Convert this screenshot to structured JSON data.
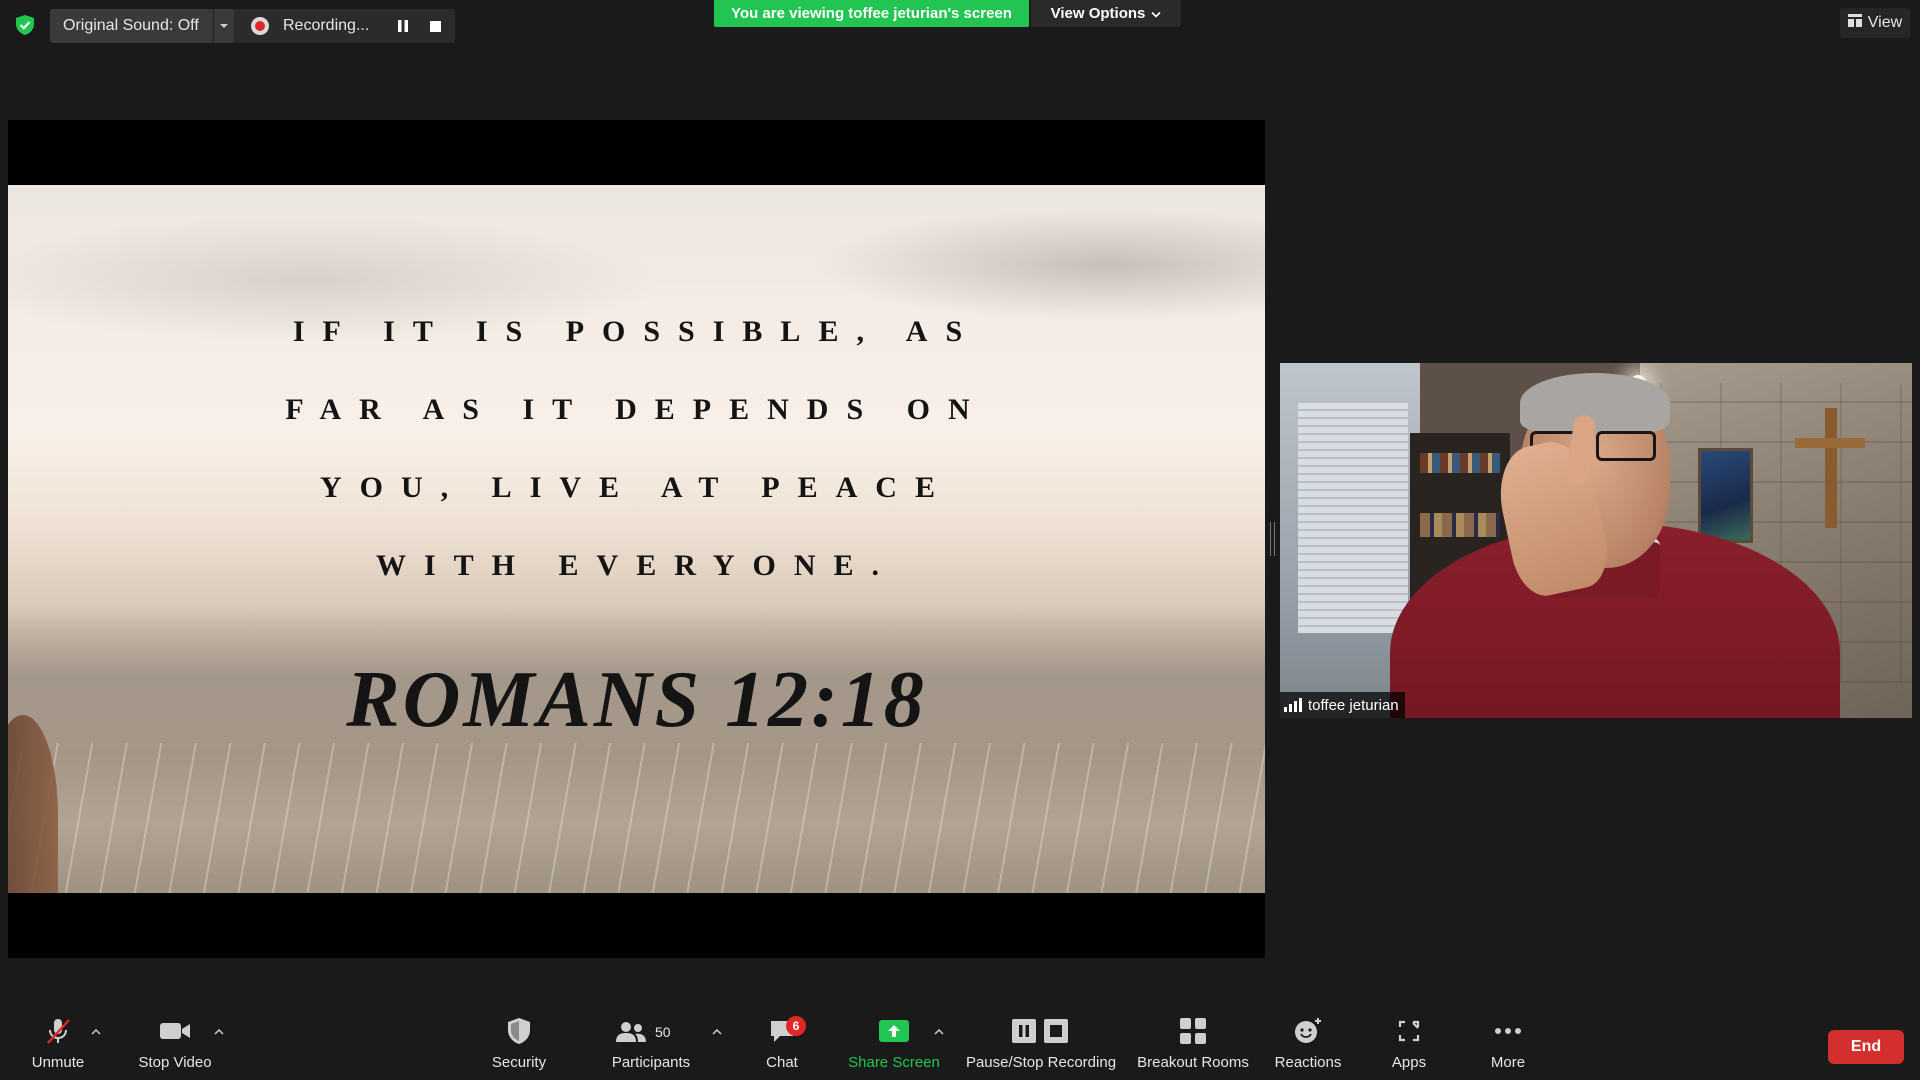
{
  "top_bar": {
    "original_sound_label": "Original Sound: Off",
    "recording_label": "Recording...",
    "viewing_banner": "You are viewing toffee jeturian's screen",
    "view_options_label": "View Options",
    "view_label": "View"
  },
  "shared_screen": {
    "verse_lines": [
      "IF IT IS POSSIBLE, AS",
      "FAR AS IT DEPENDS ON",
      "YOU, LIVE AT PEACE",
      "WITH EVERYONE."
    ],
    "reference": "ROMANS 12:18"
  },
  "participant_video": {
    "name": "toffee jeturian"
  },
  "toolbar": {
    "unmute_label": "Unmute",
    "stop_video_label": "Stop Video",
    "security_label": "Security",
    "participants_label": "Participants",
    "participants_count": "50",
    "chat_label": "Chat",
    "chat_badge": "6",
    "share_screen_label": "Share Screen",
    "pause_stop_recording_label": "Pause/Stop Recording",
    "breakout_rooms_label": "Breakout Rooms",
    "reactions_label": "Reactions",
    "apps_label": "Apps",
    "more_label": "More",
    "end_label": "End"
  },
  "colors": {
    "accent_green": "#23c552",
    "end_red": "#d32f2f",
    "background": "#1a1a1a"
  },
  "icons": [
    "shield-check-icon",
    "caret-down-icon",
    "record-dot-icon",
    "pause-icon",
    "stop-icon",
    "chevron-down-icon",
    "grid-view-icon",
    "signal-bars-icon",
    "muted-mic-icon",
    "video-camera-icon",
    "security-shield-icon",
    "participants-icon",
    "chat-bubble-icon",
    "share-screen-arrow-icon",
    "pause-stop-recording-icon",
    "breakout-rooms-icon",
    "reactions-icon",
    "apps-icon",
    "more-dots-icon"
  ]
}
